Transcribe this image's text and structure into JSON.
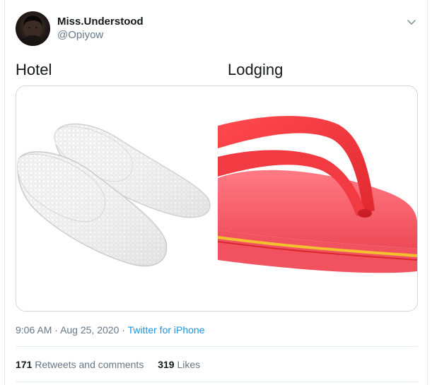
{
  "user": {
    "display_name": "Miss.Understood",
    "handle": "@Opiyow"
  },
  "tweet": {
    "caption_left": "Hotel",
    "caption_right": "Lodging"
  },
  "media": {
    "left_image": "white hotel slippers",
    "right_image": "red flip-flop"
  },
  "meta": {
    "time": "9:06 AM",
    "separator": "·",
    "date": "Aug 25, 2020",
    "source": "Twitter for iPhone"
  },
  "stats": {
    "retweets_count": "171",
    "retweets_label": "Retweets and comments",
    "likes_count": "319",
    "likes_label": "Likes"
  },
  "icons": {
    "more_menu": "chevron-down-icon"
  },
  "colors": {
    "link": "#1b95e0",
    "secondary_text": "#657786",
    "primary_text": "#14171a",
    "border": "#e6ecf0"
  }
}
